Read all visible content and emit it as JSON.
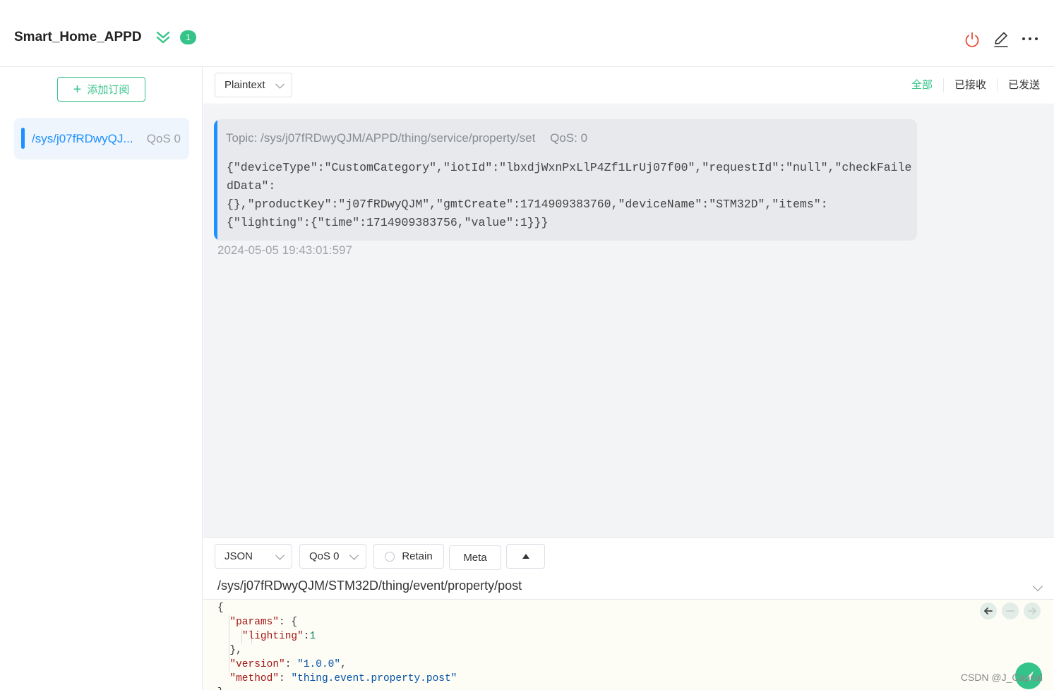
{
  "header": {
    "connection_name": "Smart_Home_APPD",
    "badge_count": "1",
    "colors": {
      "connected": "#34c388",
      "disconnect": "#e74c3c"
    }
  },
  "sidebar": {
    "add_subscription_label": "添加订阅",
    "subscriptions": [
      {
        "topic": "/sys/j07fRDwyQJ...",
        "qos": "QoS 0",
        "color": "#1e90ff"
      }
    ]
  },
  "toolbar": {
    "payload_format": "Plaintext",
    "filters": [
      "全部",
      "已接收",
      "已发送"
    ]
  },
  "messages": [
    {
      "topic_label": "Topic: /sys/j07fRDwyQJM/APPD/thing/service/property/set",
      "qos_label": "QoS: 0",
      "payload": "{\"deviceType\":\"CustomCategory\",\"iotId\":\"lbxdjWxnPxLlP4Zf1LrUj07f00\",\"requestId\":\"null\",\"checkFailedData\":\n{},\"productKey\":\"j07fRDwyQJM\",\"gmtCreate\":1714909383760,\"deviceName\":\"STM32D\",\"items\":\n{\"lighting\":{\"time\":1714909383756,\"value\":1}}}",
      "time": "2024-05-05 19:43:01:597"
    }
  ],
  "publish": {
    "format": "JSON",
    "qos": "QoS 0",
    "retain_label": "Retain",
    "meta_label": "Meta",
    "topic": "/sys/j07fRDwyQJM/STM32D/thing/event/property/post",
    "payload_lines": [
      "{",
      "  \"params\": {",
      "    \"lighting\":1",
      "  },",
      "  \"version\": \"1.0.0\",",
      "  \"method\": \"thing.event.property.post\"",
      "}"
    ]
  },
  "watermark": "CSDN @J_Capital"
}
